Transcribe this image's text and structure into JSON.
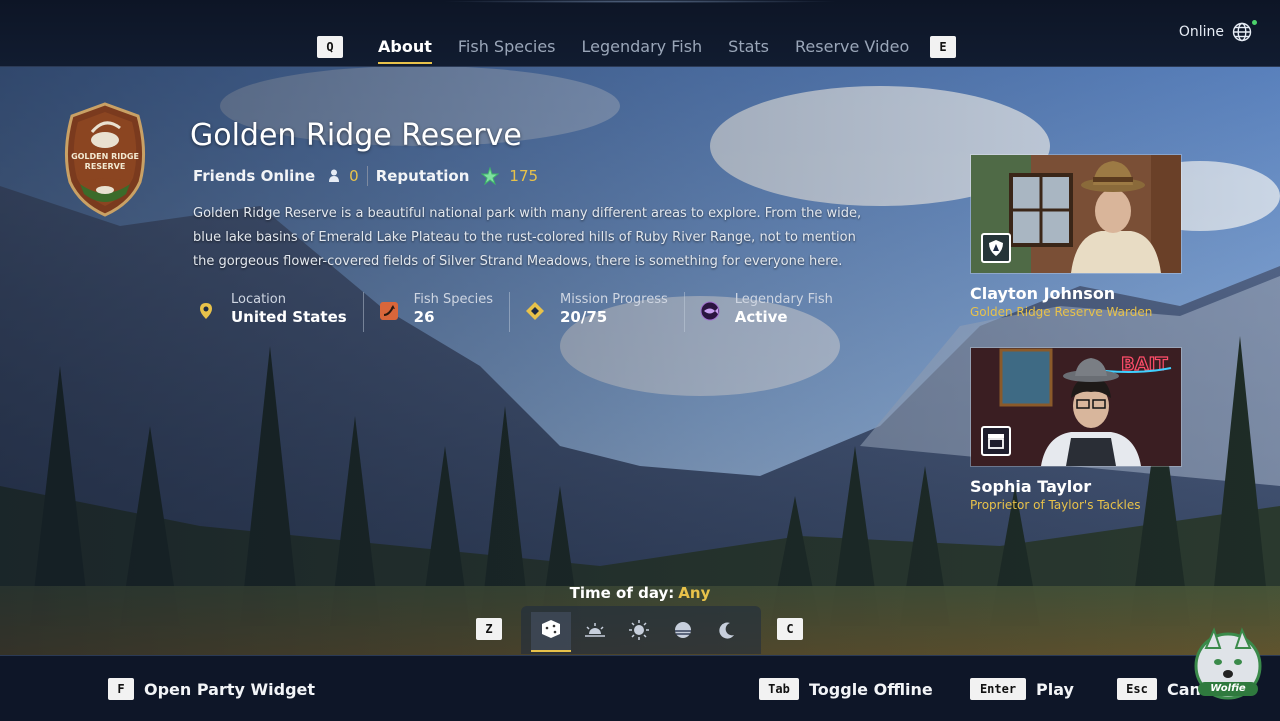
{
  "nav": {
    "prev_key": "Q",
    "next_key": "E",
    "tabs": [
      {
        "label": "About",
        "active": true
      },
      {
        "label": "Fish Species",
        "active": false
      },
      {
        "label": "Legendary Fish",
        "active": false
      },
      {
        "label": "Stats",
        "active": false
      },
      {
        "label": "Reserve Video",
        "active": false
      }
    ],
    "status": "Online"
  },
  "reserve": {
    "badge_text": "GOLDEN RIDGE RESERVE",
    "name": "Golden Ridge Reserve",
    "friends_label": "Friends Online",
    "friends_count": "0",
    "reputation_label": "Reputation",
    "reputation_value": "175",
    "description": "Golden Ridge Reserve is a beautiful national park with many different areas to explore. From the wide, blue lake basins of Emerald Lake Plateau to the rust-colored hills of Ruby River Range, not to mention the gorgeous flower-covered fields of Silver Strand Meadows, there is something for everyone here.",
    "stats": [
      {
        "label": "Location",
        "value": "United States",
        "icon": "location-pin-icon"
      },
      {
        "label": "Fish Species",
        "value": "26",
        "icon": "fish-hook-icon"
      },
      {
        "label": "Mission Progress",
        "value": "20/75",
        "icon": "diamond-icon"
      },
      {
        "label": "Legendary Fish",
        "value": "Active",
        "icon": "legendary-fish-icon"
      }
    ]
  },
  "npcs": [
    {
      "name": "Clayton Johnson",
      "role": "Golden Ridge Reserve Warden",
      "icon": "ranger-badge-icon"
    },
    {
      "name": "Sophia Taylor",
      "role": "Proprietor of Taylor's Tackles",
      "icon": "shop-icon"
    }
  ],
  "time_of_day": {
    "label": "Time of day:",
    "value": "Any",
    "prev_key": "Z",
    "next_key": "C",
    "options": [
      "random-dice-icon",
      "sunrise-icon",
      "sun-icon",
      "sunset-icon",
      "moon-icon"
    ],
    "selected_index": 0
  },
  "footer": {
    "party": {
      "key": "F",
      "label": "Open Party Widget"
    },
    "offline": {
      "key": "Tab",
      "label": "Toggle Offline"
    },
    "play": {
      "key": "Enter",
      "label": "Play"
    },
    "cancel": {
      "key": "Esc",
      "label": "Cancel"
    }
  },
  "watermark_text": "Wolfie",
  "colors": {
    "accent": "#e8c24a",
    "bar": "#0e1628",
    "online_dot": "#4cd36b"
  }
}
